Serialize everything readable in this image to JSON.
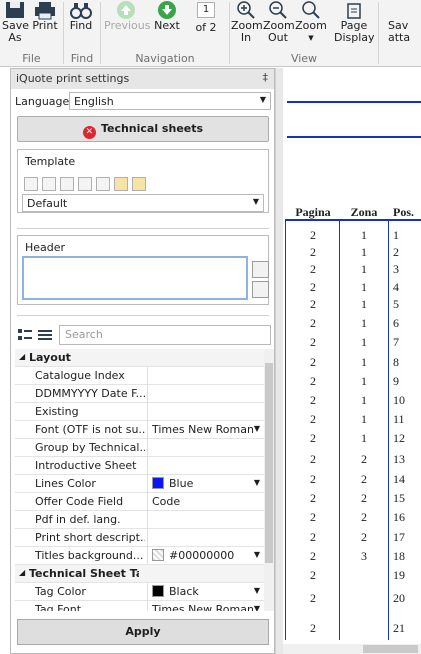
{
  "ribbon": {
    "buttons": {
      "save_as": "Save\nAs",
      "print": "Print",
      "find": "Find",
      "previous": "Previous",
      "next": "Next",
      "page_input": "1",
      "of_pages": "of 2",
      "zoom_in": "Zoom\nIn",
      "zoom_out": "Zoom\nOut",
      "zoom": "Zoom",
      "page_display": "Page\nDisplay",
      "save_attachment": "Sav\natta"
    },
    "groups": {
      "file": "File",
      "find": "Find",
      "navigation": "Navigation",
      "view": "View"
    }
  },
  "panel": {
    "title": "iQuote print settings",
    "pin": "‡",
    "language_label": "Language",
    "language_value": "English",
    "technical_sheets": "Technical sheets",
    "template_title": "Template",
    "template_value": "Default",
    "header_title": "Header",
    "search_placeholder": "Search",
    "apply": "Apply"
  },
  "properties": [
    {
      "type": "cat",
      "name": "Layout"
    },
    {
      "type": "check",
      "name": "Catalogue Index",
      "checked": true
    },
    {
      "type": "check",
      "name": "DDMMYYYY Date F...",
      "checked": true
    },
    {
      "type": "check",
      "name": "Existing",
      "checked": true
    },
    {
      "type": "select",
      "name": "Font (OTF is not su...",
      "value": "Times New Roman"
    },
    {
      "type": "check",
      "name": "Group by Technical...",
      "checked": true
    },
    {
      "type": "check",
      "name": "Introductive Sheet",
      "checked": true
    },
    {
      "type": "color",
      "name": "Lines Color",
      "value": "Blue",
      "color": "#0c17f2"
    },
    {
      "type": "text",
      "name": "Offer Code Field",
      "value": "Code"
    },
    {
      "type": "check",
      "name": "Pdf in def. lang.",
      "checked": true
    },
    {
      "type": "check",
      "name": "Print short descript...",
      "checked": false
    },
    {
      "type": "color",
      "name": "Titles background...",
      "value": "#00000000",
      "color": "transparent"
    },
    {
      "type": "cat",
      "name": "Technical Sheet Tag"
    },
    {
      "type": "color",
      "name": "Tag Color",
      "value": "Black",
      "color": "#000000"
    },
    {
      "type": "select",
      "name": "Tag Font",
      "value": "Times New Roman"
    }
  ],
  "document": {
    "headers": [
      "Pagina",
      "Zona",
      "Pos."
    ],
    "rows": [
      [
        "2",
        "1",
        "1"
      ],
      [
        "2",
        "1",
        "2"
      ],
      [
        "2",
        "1",
        "3"
      ],
      [
        "2",
        "1",
        "4"
      ],
      [
        "2",
        "1",
        "5"
      ],
      [
        "2",
        "1",
        "6"
      ],
      [
        "2",
        "1",
        "7"
      ],
      [
        "2",
        "1",
        "8"
      ],
      [
        "2",
        "1",
        "9"
      ],
      [
        "2",
        "1",
        "10"
      ],
      [
        "2",
        "1",
        "11"
      ],
      [
        "2",
        "1",
        "12"
      ],
      [
        "2",
        "2",
        "13"
      ],
      [
        "2",
        "2",
        "14"
      ],
      [
        "2",
        "2",
        "15"
      ],
      [
        "2",
        "2",
        "16"
      ],
      [
        "2",
        "2",
        "17"
      ],
      [
        "2",
        "3",
        "18"
      ],
      [
        "2",
        "",
        "19"
      ],
      [
        "2",
        "",
        "20"
      ],
      [
        "2",
        "",
        "21"
      ]
    ]
  }
}
